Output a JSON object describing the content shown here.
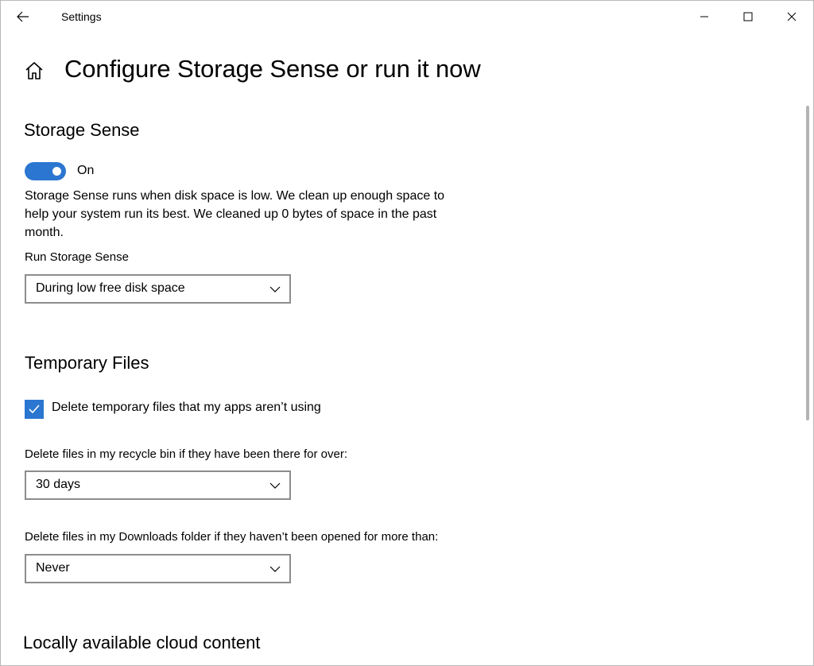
{
  "window": {
    "title": "Settings",
    "accent_color": "#2b76d0"
  },
  "titlebar": {
    "back_icon": "arrow-left-icon",
    "minimize_icon": "minimize-icon",
    "maximize_icon": "maximize-icon",
    "close_icon": "close-icon"
  },
  "header": {
    "home_icon": "home-icon",
    "title": "Configure Storage Sense or run it now"
  },
  "storage_sense": {
    "heading": "Storage Sense",
    "toggle_state": "On",
    "toggle_on": true,
    "description": "Storage Sense runs when disk space is low. We clean up enough space to help your system run its best. We cleaned up 0 bytes of space in the past month.",
    "run_label": "Run Storage Sense",
    "run_value": "During low free disk space"
  },
  "temporary_files": {
    "heading": "Temporary Files",
    "checkbox_label": "Delete temporary files that my apps aren’t using",
    "checkbox_checked": true,
    "recycle_label": "Delete files in my recycle bin if they have been there for over:",
    "recycle_value": "30 days",
    "downloads_label": "Delete files in my Downloads folder if they haven’t been opened for more than:",
    "downloads_value": "Never"
  },
  "cloud": {
    "heading": "Locally available cloud content"
  }
}
